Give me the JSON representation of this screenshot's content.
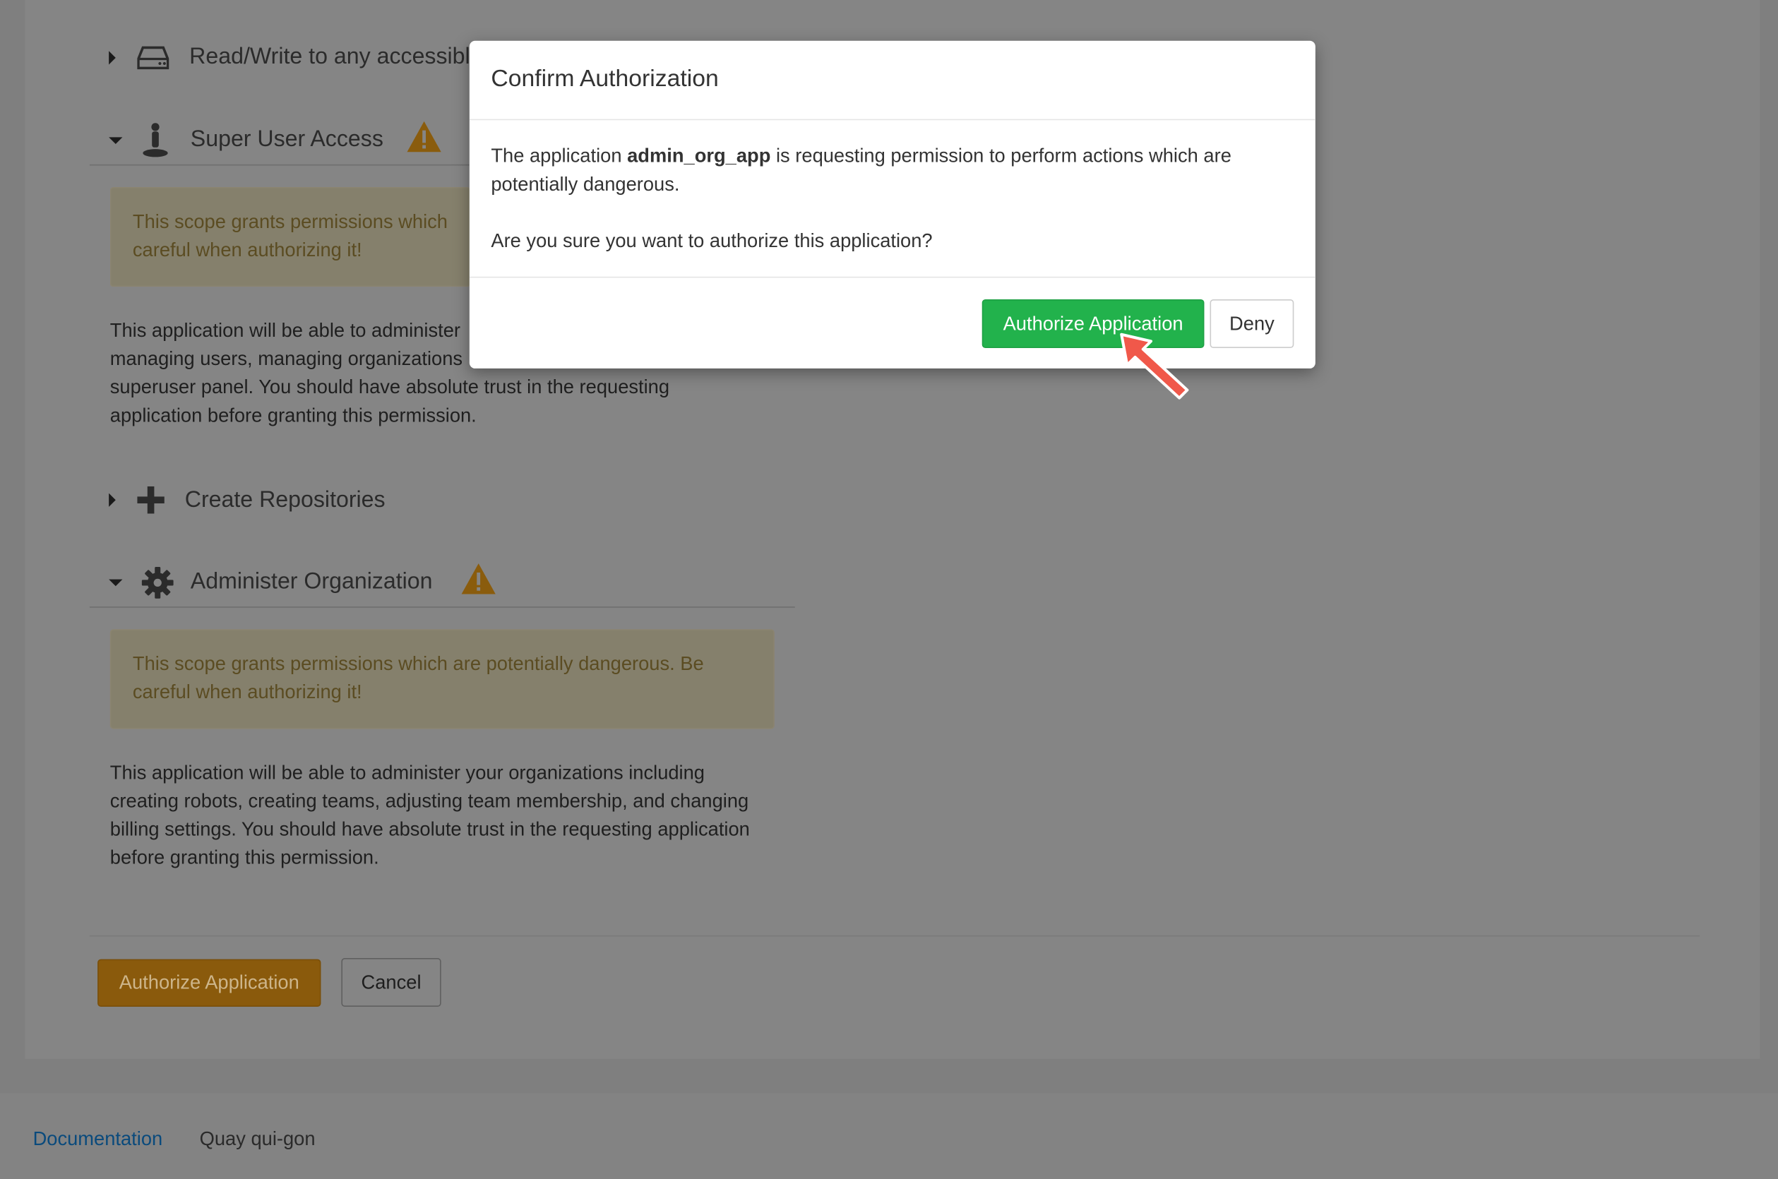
{
  "background_page": {
    "scopes": [
      {
        "label": "Read/Write to any accessible",
        "icon": "drive-icon",
        "expanded": false
      },
      {
        "label": "Super User Access",
        "icon": "user-icon",
        "expanded": true,
        "warning": true,
        "warning_text": "This scope grants permissions which a\ncareful when authorizing it!",
        "description": "This application will be able to administer\nmanaging users, managing organizations\nsuperuser panel. You should have absolute trust in the requesting\napplication before granting this permission."
      },
      {
        "label": "Create Repositories",
        "icon": "plus-icon",
        "expanded": false
      },
      {
        "label": "Administer Organization",
        "icon": "gear-icon",
        "expanded": true,
        "warning": true,
        "warning_text": "This scope grants permissions which are potentially dangerous. Be\ncareful when authorizing it!",
        "description": "This application will be able to administer your organizations including\ncreating robots, creating teams, adjusting team membership, and changing\nbilling settings. You should have absolute trust in the requesting application\nbefore granting this permission."
      }
    ],
    "authorize_label": "Authorize Application",
    "cancel_label": "Cancel"
  },
  "footer": {
    "documentation_link": "Documentation",
    "instance_name": "Quay qui-gon"
  },
  "modal": {
    "title": "Confirm Authorization",
    "body_prefix": "The application ",
    "app_name": "admin_org_app",
    "body_suffix": " is requesting permission to perform actions which are\npotentially dangerous.",
    "question": "Are you sure you want to authorize this application?",
    "authorize_label": "Authorize Application",
    "deny_label": "Deny"
  },
  "colors": {
    "authorize_green": "#22b24c",
    "authorize_orange": "#e8940f",
    "warning_icon": "#f0a30a",
    "link_blue": "#0a4a7c"
  }
}
